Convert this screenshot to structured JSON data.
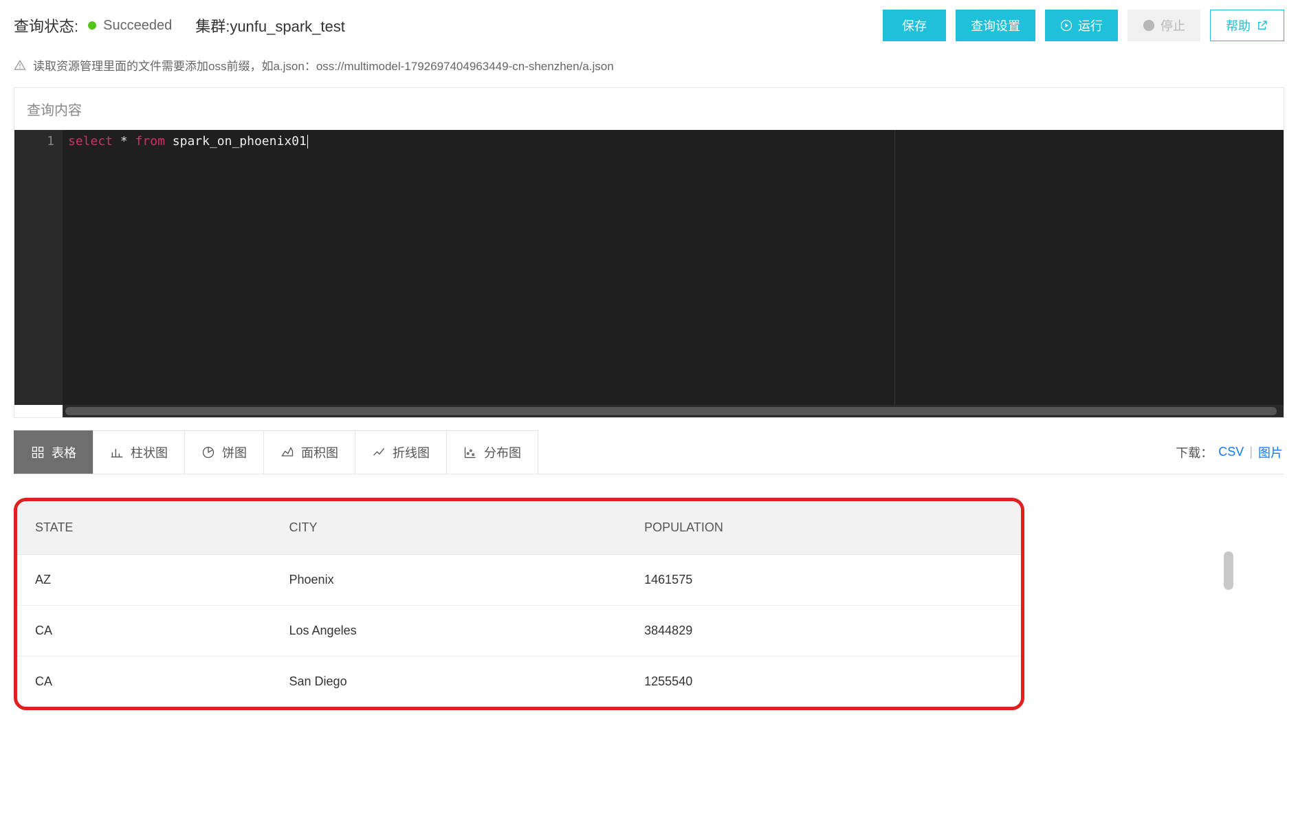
{
  "header": {
    "status_label": "查询状态:",
    "status_value": "Succeeded",
    "status_color": "#52c41a",
    "cluster_label": "集群:yunfu_spark_test",
    "buttons": {
      "save": "保存",
      "settings": "查询设置",
      "run": "运行",
      "stop": "停止",
      "help": "帮助"
    }
  },
  "info": {
    "text": "读取资源管理里面的文件需要添加oss前缀，如a.json：oss://multimodel-1792697404963449-cn-shenzhen/a.json"
  },
  "editor": {
    "title": "查询内容",
    "line_number": "1",
    "kw1": "select",
    "star": "*",
    "kw2": "from",
    "table": "spark_on_phoenix01"
  },
  "tabs": {
    "table": "表格",
    "bar": "柱状图",
    "pie": "饼图",
    "area": "面积图",
    "line": "折线图",
    "scatter": "分布图"
  },
  "download": {
    "label": "下载：",
    "csv": "CSV",
    "image": "图片"
  },
  "results": {
    "columns": [
      "STATE",
      "CITY",
      "POPULATION"
    ],
    "rows": [
      {
        "state": "AZ",
        "city": "Phoenix",
        "population": "1461575"
      },
      {
        "state": "CA",
        "city": "Los Angeles",
        "population": "3844829"
      },
      {
        "state": "CA",
        "city": "San Diego",
        "population": "1255540"
      }
    ]
  }
}
